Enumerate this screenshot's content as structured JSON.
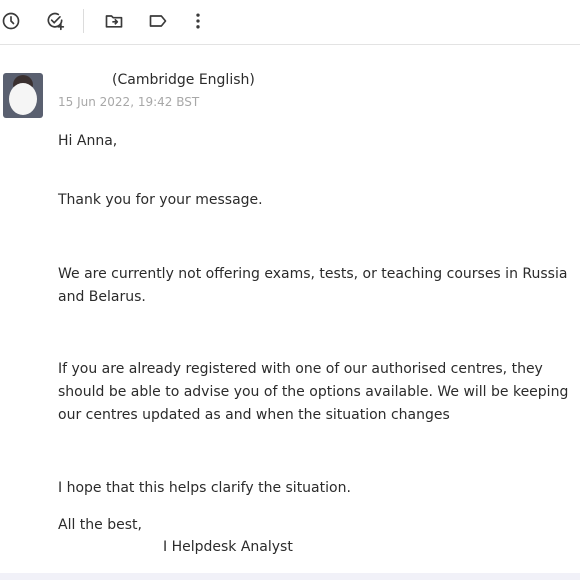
{
  "toolbar": {
    "icons": [
      "clock-icon",
      "task-add-icon",
      "move-to-folder-icon",
      "label-icon",
      "more-vert-icon"
    ]
  },
  "message": {
    "sender": "(Cambridge English)",
    "timestamp": "15 Jun 2022, 19:42 BST",
    "greeting": "Hi Anna,",
    "paragraphs": [
      "Thank you for your message.",
      "We are currently not offering exams, tests, or teaching courses in Russia and Belarus.",
      "If you are already registered with one of our authorised centres, they should be able to advise you of the options available. We will be keeping our centres updated as and when the situation changes",
      "I hope that this helps clarify the situation."
    ],
    "closing": "All the best,",
    "signature": "I Helpdesk Analyst"
  },
  "colors": {
    "text": "#2b2b2b",
    "muted": "#a8a8a8",
    "divider": "#e3e3e3",
    "footer": "#f1f1f8"
  }
}
